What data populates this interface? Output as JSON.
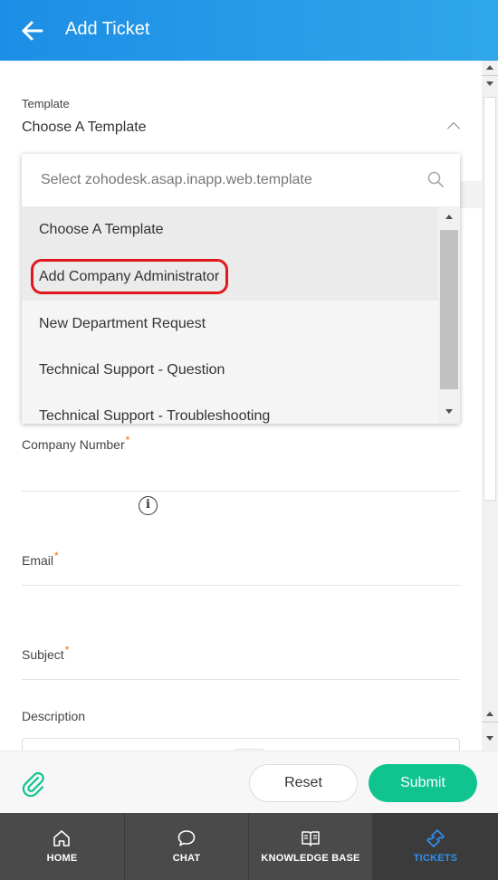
{
  "header": {
    "title": "Add Ticket",
    "back_icon": "arrow-left-icon"
  },
  "form": {
    "template": {
      "label": "Template",
      "value": "Choose A Template",
      "dropdown": {
        "search_placeholder": "Select zohodesk.asap.inapp.web.template",
        "options": [
          "Choose A Template",
          "Add Company Administrator",
          "New Department Request",
          "Technical Support - Question",
          "Technical Support - Troubleshooting"
        ],
        "selected_option": "Choose A Template",
        "highlighted_option": "Add Company Administrator"
      }
    },
    "company_number": {
      "label": "Company Number",
      "required_mark": "*"
    },
    "email": {
      "label": "Email",
      "required_mark": "*"
    },
    "subject": {
      "label": "Subject",
      "required_mark": "*"
    },
    "description": {
      "label": "Description"
    }
  },
  "footer": {
    "attach_icon": "paperclip-icon",
    "reset_label": "Reset",
    "submit_label": "Submit"
  },
  "nav": {
    "items": [
      {
        "label": "HOME",
        "icon": "home-icon"
      },
      {
        "label": "CHAT",
        "icon": "chat-icon"
      },
      {
        "label": "KNOWLEDGE BASE",
        "icon": "book-icon"
      },
      {
        "label": "TICKETS",
        "icon": "ticket-icon",
        "active": true
      }
    ]
  },
  "colors": {
    "header": "#1d8ee6",
    "submit": "#0fc48f",
    "nav_bg": "#4a4a4a",
    "nav_active": "#2f8ff0",
    "required": "#ff6a00",
    "highlight": "#e0181d"
  }
}
